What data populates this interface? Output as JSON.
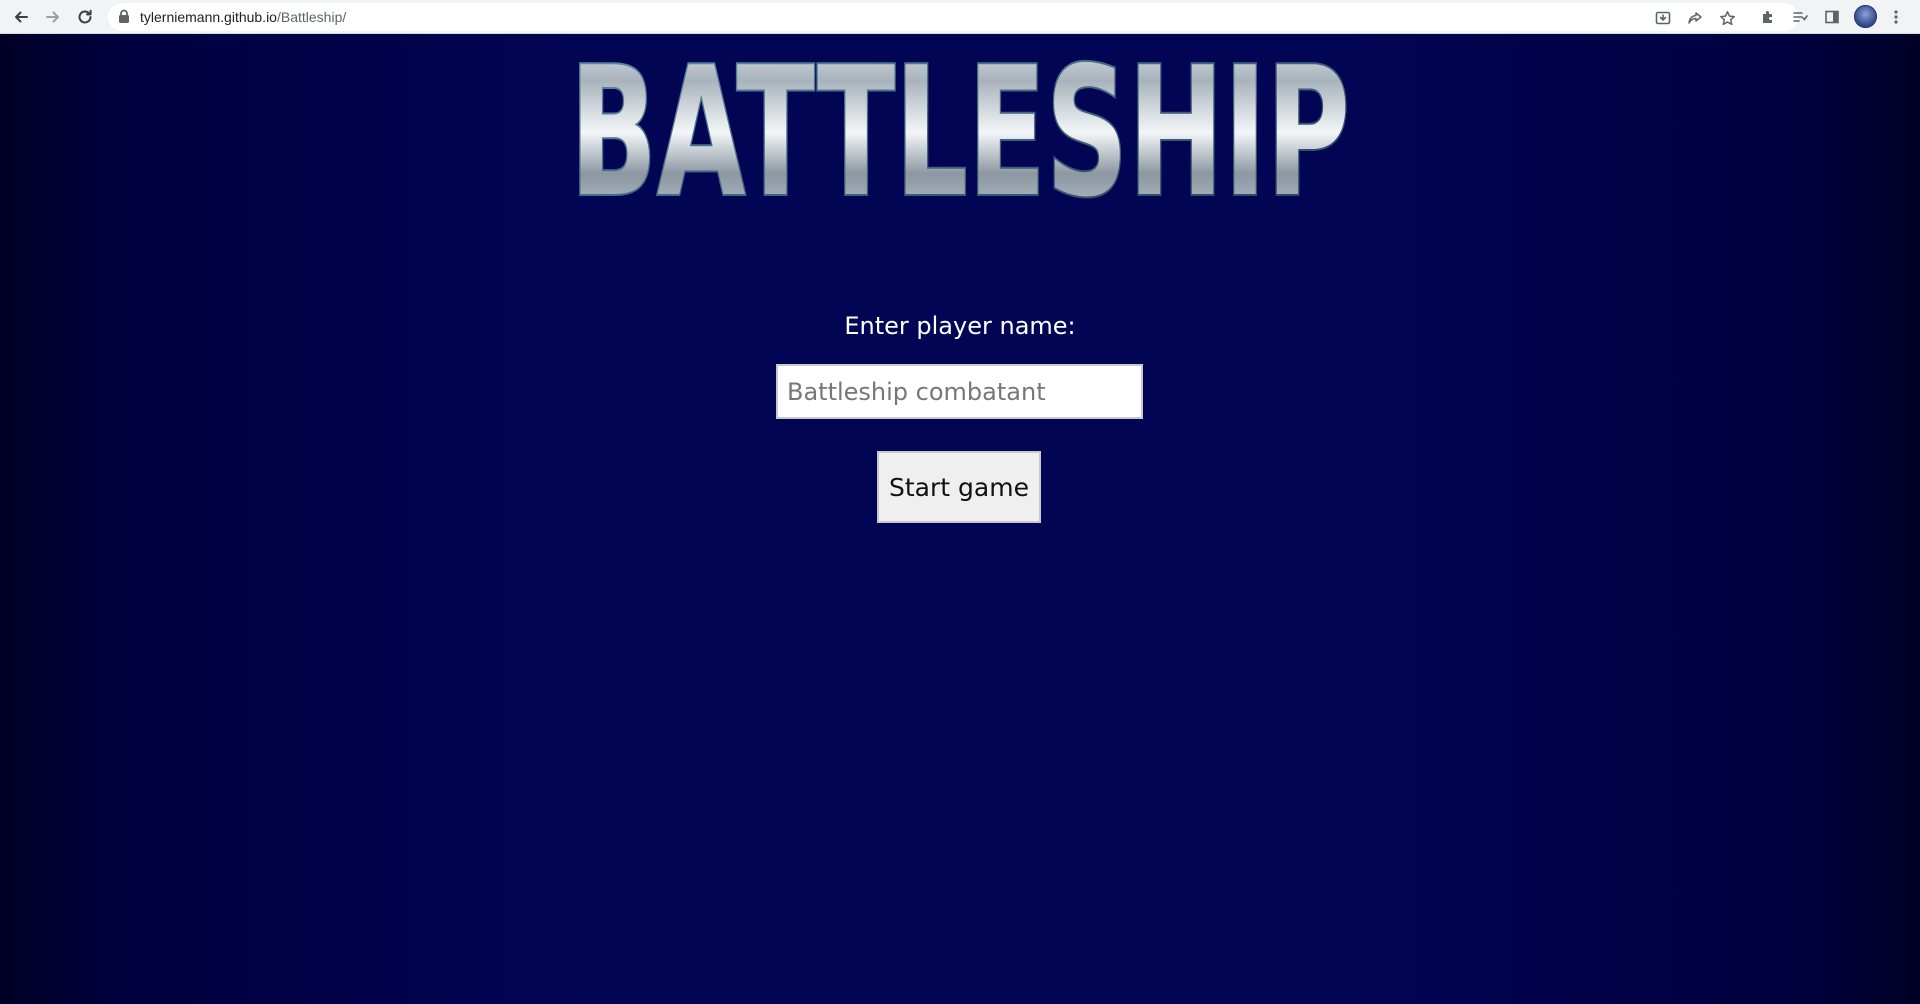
{
  "browser": {
    "url_host": "tylerniemann.github.io",
    "url_path": "/Battleship/"
  },
  "icons": {
    "back": "arrow-left-icon",
    "forward": "arrow-right-icon",
    "reload": "reload-icon",
    "lock": "lock-icon",
    "install": "install-app-icon",
    "share": "share-icon",
    "bookmark": "star-icon",
    "extensions": "puzzle-icon",
    "reading_list": "reading-list-icon",
    "side_panel": "side-panel-icon",
    "menu": "kebab-menu-icon"
  },
  "page": {
    "logo_text": "BATTLESHIP",
    "prompt": "Enter player name:",
    "name_input": {
      "value": "",
      "placeholder": "Battleship combatant"
    },
    "start_button": "Start game"
  },
  "colors": {
    "background": "#020454",
    "button_bg": "#efefef",
    "text_light": "#ffffff"
  }
}
